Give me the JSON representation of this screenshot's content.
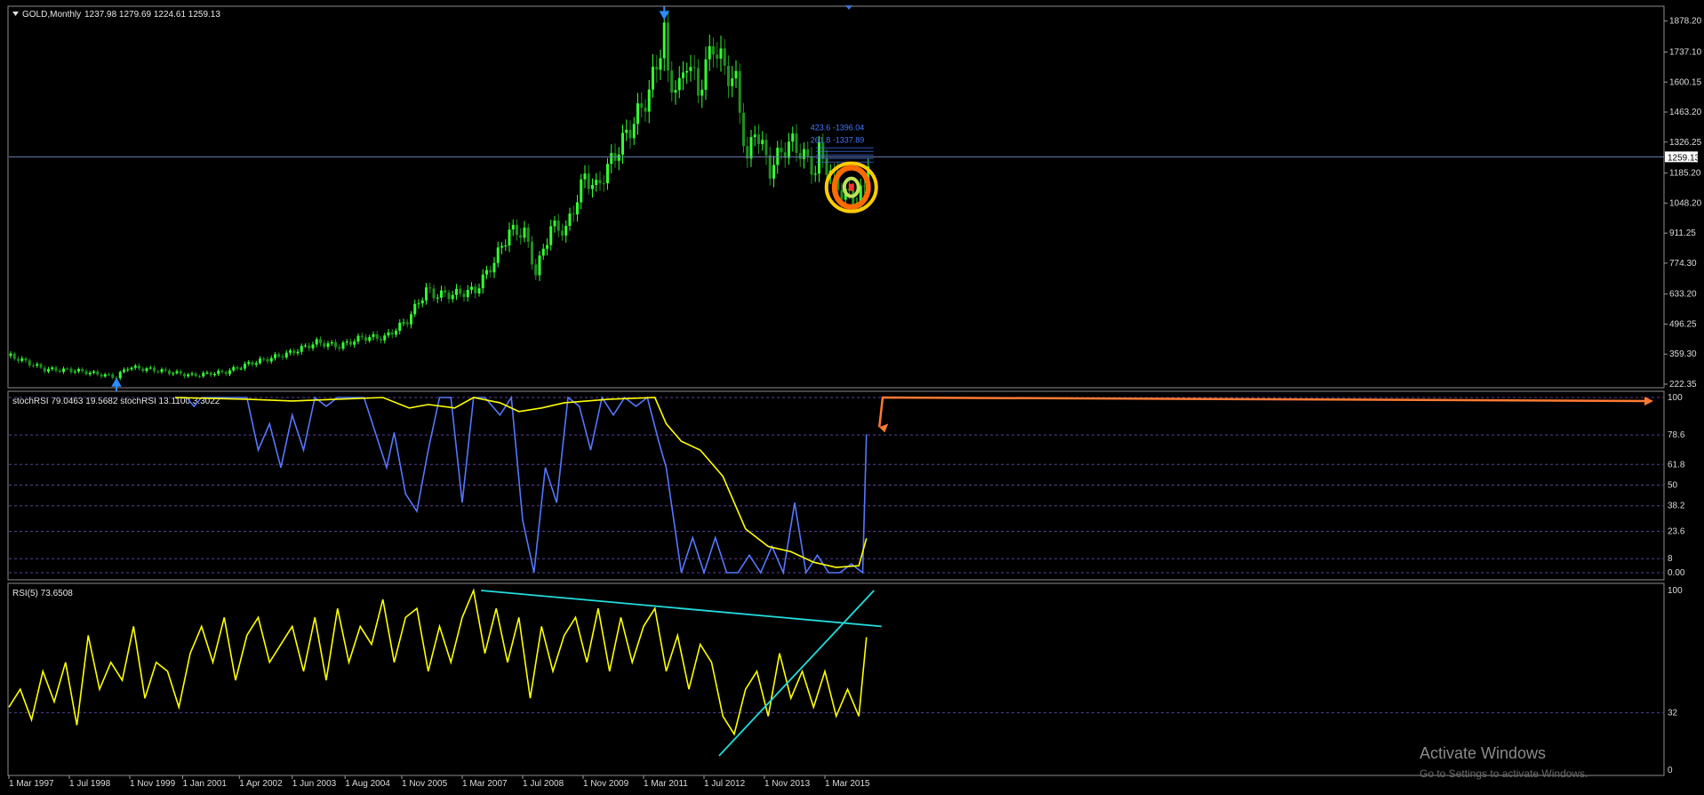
{
  "window": {
    "title": "GOLD,Monthly",
    "ohlc": "1237.98 1279.69 1224.61 1259.13"
  },
  "watermark": {
    "line1": "Activate Windows",
    "line2": "Go to Settings to activate Windows."
  },
  "colors": {
    "background": "#000000",
    "bull": "#33ff33",
    "bear": "#1f8f1f",
    "price_line": "#6d7eb5",
    "stoch_k": "#5577ff",
    "stoch_d": "#ffff00",
    "rsi": "#ffff00",
    "trendline": "#22dddd",
    "arrow": "#ff7a33",
    "fib": "#4477ff",
    "pattern_outer": "#ffcc00",
    "pattern_mid": "#ff6a00"
  },
  "icons": {
    "collapse": "triangle-down-icon",
    "fractal_up": "blue-arrow-down-icon",
    "fractal_low": "blue-arrow-up-icon"
  },
  "chart_data": [
    {
      "type": "candlestick",
      "title": "GOLD,Monthly",
      "last_price": "1259.13",
      "ylim": [
        222.35,
        1950
      ],
      "price_ticks": [
        "1878.20",
        "1737.10",
        "1600.15",
        "1463.20",
        "1326.25",
        "1185.20",
        "1048.20",
        "911.25",
        "774.30",
        "633.20",
        "496.25",
        "359.30",
        "222.35"
      ],
      "x_labels": [
        "1 Mar 1997",
        "1 Jul 1998",
        "1 Nov 1999",
        "1 Jan 2001",
        "1 Apr 2002",
        "1 Jun 2003",
        "1 Aug 2004",
        "1 Nov 2005",
        "1 Mar 2007",
        "1 Jul 2008",
        "1 Nov 2009",
        "1 Mar 2011",
        "1 Jul 2012",
        "1 Nov 2013",
        "1 Mar 2015"
      ],
      "x_range": [
        "1997-03",
        "2016-02"
      ],
      "close_anchors": [
        [
          "1997-03",
          351
        ],
        [
          "1997-12",
          290
        ],
        [
          "1998-08",
          285
        ],
        [
          "1999-07",
          255
        ],
        [
          "1999-10",
          300
        ],
        [
          "2000-06",
          285
        ],
        [
          "2001-03",
          262
        ],
        [
          "2001-12",
          278
        ],
        [
          "2002-06",
          315
        ],
        [
          "2002-12",
          342
        ],
        [
          "2003-05",
          365
        ],
        [
          "2003-12",
          413
        ],
        [
          "2004-06",
          395
        ],
        [
          "2004-12",
          435
        ],
        [
          "2005-06",
          435
        ],
        [
          "2005-12",
          513
        ],
        [
          "2006-05",
          652
        ],
        [
          "2006-07",
          630
        ],
        [
          "2006-12",
          632
        ],
        [
          "2007-06",
          650
        ],
        [
          "2007-11",
          783
        ],
        [
          "2008-03",
          920
        ],
        [
          "2008-07",
          915
        ],
        [
          "2008-10",
          730
        ],
        [
          "2009-02",
          940
        ],
        [
          "2009-06",
          926
        ],
        [
          "2009-11",
          1170
        ],
        [
          "2010-02",
          1115
        ],
        [
          "2010-06",
          1240
        ],
        [
          "2010-12",
          1420
        ],
        [
          "2011-04",
          1550
        ],
        [
          "2011-08",
          1825
        ],
        [
          "2011-09",
          1620
        ],
        [
          "2011-12",
          1565
        ],
        [
          "2012-02",
          1710
        ],
        [
          "2012-05",
          1560
        ],
        [
          "2012-09",
          1775
        ],
        [
          "2012-12",
          1660
        ],
        [
          "2013-03",
          1595
        ],
        [
          "2013-06",
          1230
        ],
        [
          "2013-08",
          1395
        ],
        [
          "2013-12",
          1200
        ],
        [
          "2014-03",
          1285
        ],
        [
          "2014-06",
          1325
        ],
        [
          "2014-12",
          1195
        ],
        [
          "2015-01",
          1280
        ],
        [
          "2015-07",
          1095
        ],
        [
          "2015-11",
          1065
        ],
        [
          "2016-01",
          1118
        ],
        [
          "2016-02",
          1259
        ]
      ],
      "fib_labels": [
        "423.6 -1396.04",
        "261.8 -1337.89"
      ],
      "fractal_markers": [
        "2011-08",
        "1999-07"
      ]
    },
    {
      "type": "line",
      "title": "stochRSI 79.0463 19.5682  stochRSI 13.1100 3.3022",
      "ylim": [
        0,
        100
      ],
      "levels": [
        "100",
        "78.6",
        "61.8",
        "50",
        "38.2",
        "23.6",
        "8",
        "0.00"
      ],
      "level_values": [
        100,
        78.6,
        61.8,
        50,
        38.2,
        23.6,
        8,
        0
      ],
      "extra_ticks": [
        "100",
        "0.00"
      ],
      "series": [
        {
          "values_x": [
            "2000-11",
            "2001-02",
            "2001-04",
            "2001-06",
            "2002-06",
            "2002-09",
            "2002-12",
            "2003-03",
            "2003-06",
            "2003-09",
            "2003-12",
            "2004-03",
            "2004-06",
            "2004-09",
            "2005-01",
            "2005-04",
            "2005-07",
            "2005-09",
            "2005-12",
            "2006-03",
            "2006-06",
            "2006-09",
            "2006-12",
            "2007-03",
            "2007-06",
            "2007-09",
            "2008-01",
            "2008-04",
            "2008-07",
            "2008-10",
            "2009-01",
            "2009-04",
            "2009-07",
            "2009-10",
            "2010-01",
            "2010-04",
            "2010-07",
            "2010-10",
            "2011-01",
            "2011-04",
            "2011-07",
            "2011-09",
            "2012-01",
            "2012-04",
            "2012-07",
            "2012-10",
            "2013-01",
            "2013-04",
            "2013-07",
            "2013-10",
            "2014-01",
            "2014-04",
            "2014-07",
            "2014-10",
            "2015-01",
            "2015-04",
            "2015-07",
            "2015-10",
            "2016-01",
            "2016-02"
          ],
          "values": [
            100,
            100,
            95,
            100,
            100,
            70,
            85,
            60,
            90,
            70,
            100,
            95,
            100,
            100,
            100,
            80,
            60,
            80,
            45,
            35,
            70,
            100,
            100,
            40,
            100,
            100,
            90,
            100,
            30,
            0,
            60,
            40,
            100,
            95,
            70,
            100,
            90,
            100,
            95,
            100,
            75,
            60,
            0,
            20,
            0,
            20,
            0,
            0,
            10,
            0,
            15,
            0,
            40,
            0,
            10,
            0,
            0,
            5,
            0,
            79
          ]
        },
        {
          "values_x": [
            "2000-11",
            "2002-06",
            "2003-06",
            "2004-06",
            "2005-06",
            "2006-01",
            "2006-06",
            "2007-01",
            "2007-06",
            "2008-01",
            "2008-06",
            "2008-12",
            "2009-06",
            "2010-06",
            "2011-06",
            "2011-09",
            "2012-01",
            "2012-06",
            "2012-12",
            "2013-06",
            "2013-12",
            "2014-06",
            "2014-12",
            "2015-06",
            "2015-12",
            "2016-02"
          ],
          "values": [
            100,
            99,
            98,
            99,
            100,
            94,
            96,
            94,
            100,
            97,
            92,
            94,
            97,
            99,
            100,
            85,
            75,
            70,
            55,
            25,
            15,
            12,
            6,
            3,
            4,
            19.6
          ]
        }
      ],
      "arrow_label": ""
    },
    {
      "type": "line",
      "title": "RSI(5) 73.6508",
      "ylim": [
        0,
        100
      ],
      "levels": [
        "100",
        "32",
        "0"
      ],
      "level_values": [
        100,
        32,
        0
      ],
      "series": [
        {
          "values_x": [
            "1997-03",
            "1997-06",
            "1997-09",
            "1997-12",
            "1998-03",
            "1998-06",
            "1998-09",
            "1998-12",
            "1999-03",
            "1999-06",
            "1999-09",
            "1999-12",
            "2000-03",
            "2000-06",
            "2000-09",
            "2000-12",
            "2001-03",
            "2001-06",
            "2001-09",
            "2001-12",
            "2002-03",
            "2002-06",
            "2002-09",
            "2002-12",
            "2003-03",
            "2003-06",
            "2003-09",
            "2003-12",
            "2004-03",
            "2004-06",
            "2004-09",
            "2004-12",
            "2005-03",
            "2005-06",
            "2005-09",
            "2005-12",
            "2006-03",
            "2006-06",
            "2006-09",
            "2006-12",
            "2007-03",
            "2007-06",
            "2007-09",
            "2007-12",
            "2008-03",
            "2008-06",
            "2008-09",
            "2008-12",
            "2009-03",
            "2009-06",
            "2009-09",
            "2009-12",
            "2010-03",
            "2010-06",
            "2010-09",
            "2010-12",
            "2011-03",
            "2011-06",
            "2011-09",
            "2011-12",
            "2012-03",
            "2012-06",
            "2012-09",
            "2012-12",
            "2013-03",
            "2013-06",
            "2013-09",
            "2013-12",
            "2014-03",
            "2014-06",
            "2014-09",
            "2014-12",
            "2015-03",
            "2015-06",
            "2015-09",
            "2015-12",
            "2016-02"
          ],
          "values": [
            35,
            45,
            28,
            55,
            38,
            60,
            25,
            75,
            45,
            60,
            50,
            80,
            40,
            60,
            55,
            35,
            65,
            80,
            60,
            85,
            50,
            75,
            85,
            60,
            70,
            80,
            55,
            85,
            50,
            90,
            60,
            80,
            70,
            95,
            60,
            85,
            90,
            55,
            80,
            60,
            85,
            100,
            65,
            90,
            60,
            85,
            40,
            80,
            55,
            75,
            85,
            60,
            90,
            55,
            85,
            60,
            80,
            90,
            55,
            75,
            45,
            70,
            60,
            30,
            20,
            45,
            55,
            30,
            65,
            40,
            55,
            35,
            55,
            30,
            45,
            30,
            74
          ]
        },
        {
          "values_x": [
            "2007-08",
            "2016-06"
          ],
          "values": [
            100,
            80
          ]
        },
        {
          "values_x": [
            "2012-11",
            "2016-04"
          ],
          "values": [
            8,
            100
          ]
        }
      ]
    }
  ]
}
